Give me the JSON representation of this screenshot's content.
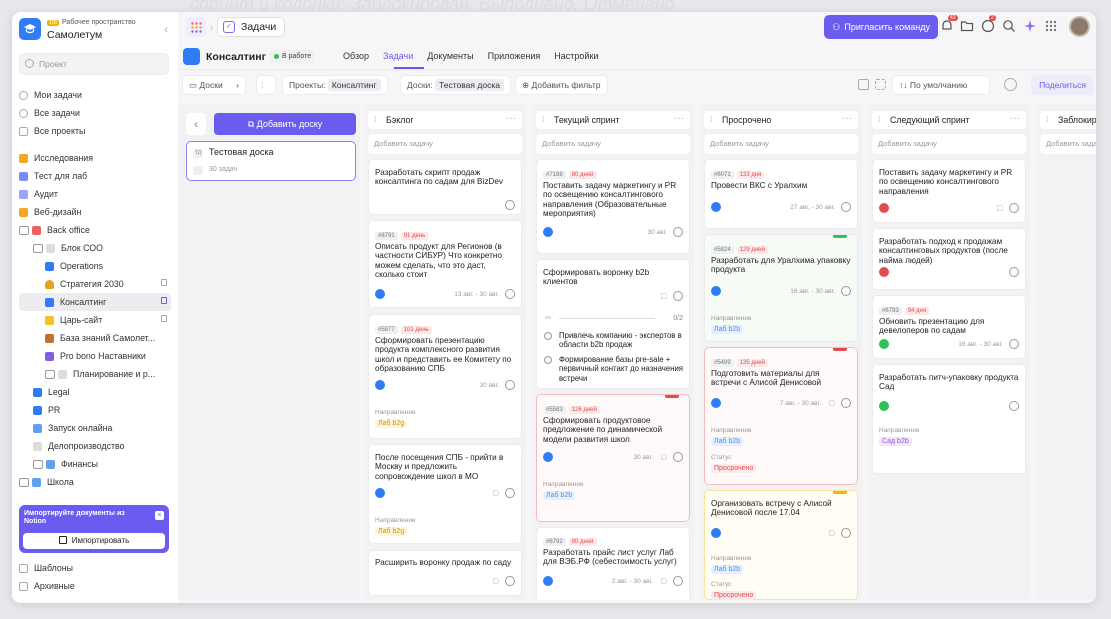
{
  "bg_text": "спринт и колонки: Заблокирован, Выполнено, Отменено",
  "workspace": {
    "badge": "100",
    "subtitle": "Рабочее пространство",
    "name": "Самолетум"
  },
  "search": {
    "placeholder": "Проект"
  },
  "nav_main": [
    {
      "label": "Мои задачи"
    },
    {
      "label": "Все задачи"
    },
    {
      "label": "Все проекты"
    }
  ],
  "nav_projects": [
    {
      "label": "Исследования",
      "color": "#f5a623"
    },
    {
      "label": "Тест для лаб",
      "color": "#7b8cf5"
    },
    {
      "label": "Аудит",
      "color": "#9aa5f5"
    },
    {
      "label": "Веб-дизайн",
      "color": "#f5a623"
    },
    {
      "label": "Back office",
      "color": "#f06060"
    },
    {
      "label": "Блок СОО",
      "color": "#bbbbbb"
    },
    {
      "label": "Operations",
      "color": "#2f7df6"
    },
    {
      "label": "Стратегия 2030",
      "color": "#e8a020"
    },
    {
      "label": "Консалтинг",
      "color": "#2f7df6"
    },
    {
      "label": "Царь-сайт",
      "color": "#f5c020"
    },
    {
      "label": "База знаний Самолет...",
      "color": "#c07030"
    },
    {
      "label": "Pro bono Наставники",
      "color": "#8060e0"
    },
    {
      "label": "Планирование и р...",
      "color": "#bbbbbb"
    },
    {
      "label": "Legal",
      "color": "#2f7df6"
    },
    {
      "label": "PR",
      "color": "#2f7df6"
    },
    {
      "label": "Запуск онлайна",
      "color": "#60a0f0"
    },
    {
      "label": "Делопроизводство",
      "color": "#bbbbbb"
    },
    {
      "label": "Финансы",
      "color": "#60a0f0"
    },
    {
      "label": "Школа",
      "color": "#60a0f0"
    }
  ],
  "promo": {
    "text": "Импортируйте документы из Notion",
    "button": "Импортировать"
  },
  "nav_bottom": [
    {
      "label": "Шаблоны"
    },
    {
      "label": "Архивные"
    }
  ],
  "topbar": {
    "tab": "Задачи",
    "invite": "Пригласить команду",
    "notif_count": "43",
    "help_count": "2"
  },
  "project": {
    "title": "Консалтинг",
    "status": "В работе",
    "nav": [
      "Обзор",
      "Задачи",
      "Документы",
      "Приложения",
      "Настройки"
    ],
    "active": "Задачи"
  },
  "filters": {
    "boards": "Доски",
    "projects_label": "Проекты:",
    "projects_value": "Консалтинг",
    "boards_label": "Доски:",
    "boards_value": "Тестовая доска",
    "add_filter": "Добавить фильтр",
    "sort": "По умолчанию",
    "share": "Поделиться"
  },
  "boards_panel": {
    "add": "Добавить доску",
    "board_name": "Тестовая доска",
    "board_count": "30 задач",
    "board_icon": "ТД"
  },
  "add_task": "Добавить задачу",
  "colors": {
    "accent": "#6b5cf0",
    "blue": "#2f7df6",
    "red": "#e14d4d",
    "green": "#2ec15a"
  },
  "columns": [
    {
      "name": "Бэклог",
      "cards": [
        {
          "title": "Разработать скрипт продаж консалтинга по садам для BizDev"
        },
        {
          "id": "#8791",
          "badge": "91 день",
          "title": "Описать продукт для Регионов (в частности СИБУР) Что конкретно можем сделать, что это даст, сколько стоит",
          "date": "13 авг. - 30 авг."
        },
        {
          "id": "#5877",
          "badge": "101 день",
          "title": "Сформировать презентацию продукта комплексного развития школ и представить ее Комитету по образованию СПБ",
          "date": "30 авг.",
          "label": "Направление",
          "pill": "Лаб b2g"
        },
        {
          "title": "После посещения СПБ - прийти в Москву и предложить сопровождение школ в МО",
          "label": "Направление",
          "pill": "Лаб b2g"
        },
        {
          "title": "Расширить воронку продаж по саду"
        }
      ]
    },
    {
      "name": "Текущий спринт",
      "cards": [
        {
          "id": "#7188",
          "badge": "80 дней",
          "title": "Поставить задачу маркетингу и PR по освещению консалтингового направления (Образовательные мероприятия)",
          "date": "30 авг."
        },
        {
          "title": "Сформировать воронку b2b клиентов",
          "progress": "0/2",
          "subtasks": [
            "Привлечь компанию - экспертов в области b2b продаж",
            "Формирование базы pre-sale + первичный контакт до назначения встречи"
          ]
        },
        {
          "id": "#5583",
          "badge": "126 дней",
          "title": "Сформировать продуктовое предложение по динамической модели развития школ",
          "date": "30 авг.",
          "label": "Направление",
          "pill": "Лаб b2b"
        },
        {
          "id": "#6792",
          "badge": "80 дней",
          "title": "Разработать прайс лист услуг Лаб для ВЭБ.РФ (себестоимость услуг)",
          "date": "2 авг. - 30 авг."
        }
      ]
    },
    {
      "name": "Просрочено",
      "cards": [
        {
          "id": "#6071",
          "badge": "133 дня",
          "title": "Провести ВКС с Уралхим",
          "date": "27 авг. - 30 авг."
        },
        {
          "id": "#5824",
          "badge": "129 дней",
          "title": "Разработать для Уралхима упаковку продукта",
          "date": "16 авг. - 30 авг.",
          "label": "Направление",
          "pill": "Лаб b2b"
        },
        {
          "id": "#5499",
          "badge": "135 дней",
          "title": "Подготовить материалы для встречи с Алисой Денисовой",
          "date": "7 авг. - 30 авг.",
          "label": "Направление",
          "pill": "Лаб b2b",
          "label2": "Статус",
          "status": "Просрочено"
        },
        {
          "title": "Организовать встречу с Алисой Денисовой после 17.04",
          "label": "Направление",
          "pill": "Лаб b2b",
          "label2": "Статус",
          "status": "Просрочено"
        }
      ]
    },
    {
      "name": "Следующий спринт",
      "cards": [
        {
          "title": "Поставить задачу маркетингу и PR по освещению консалтингового направления"
        },
        {
          "title": "Разработать подход к продажам консалтинговых продуктов (после найма людей)"
        },
        {
          "id": "#6793",
          "badge": "94 дня",
          "title": "Обновить презентацию для девелоперов по садам",
          "date": "16 авг. - 30 авг."
        },
        {
          "title": "Разработать питч-упаковку продукта Сад",
          "label": "Направление",
          "pill": "Сад b2b"
        }
      ]
    },
    {
      "name": "Заблокир",
      "cards": []
    }
  ]
}
